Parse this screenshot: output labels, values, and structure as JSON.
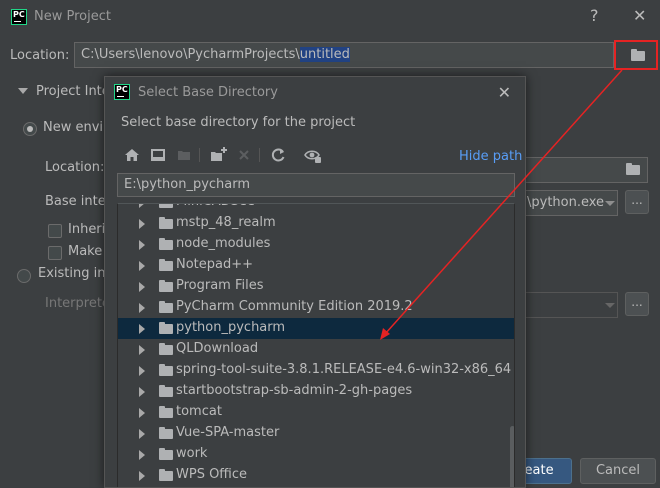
{
  "window": {
    "title": "New Project",
    "location_label": "Location:",
    "location_prefix": "C:\\Users\\lenovo\\PycharmProjects\\",
    "location_selected": "untitled",
    "interpreter_section": "Project Interpreter",
    "new_env_label": "New environment",
    "sub_location_label": "Location:",
    "base_interpreter_label": "Base interpreter",
    "base_interpreter_value": "\\python.exe",
    "inherit_label": "Inherit",
    "make_label": "Make",
    "existing_label": "Existing interpreter",
    "interpreter_label": "Interpreter",
    "create_button": "Create",
    "cancel_button": "Cancel",
    "browse_button": "..."
  },
  "dialog": {
    "title": "Select Base Directory",
    "description": "Select base directory for the project",
    "hide_path": "Hide path",
    "path_value": "E:\\python_pycharm",
    "items": [
      {
        "name": "MiniCADSee"
      },
      {
        "name": "mstp_48_realm"
      },
      {
        "name": "node_modules"
      },
      {
        "name": "Notepad++"
      },
      {
        "name": "Program Files"
      },
      {
        "name": "PyCharm Community Edition 2019.2"
      },
      {
        "name": "python_pycharm",
        "selected": true
      },
      {
        "name": "QLDownload"
      },
      {
        "name": "spring-tool-suite-3.8.1.RELEASE-e4.6-win32-x86_64"
      },
      {
        "name": "startbootstrap-sb-admin-2-gh-pages"
      },
      {
        "name": "tomcat"
      },
      {
        "name": "Vue-SPA-master"
      },
      {
        "name": "work"
      },
      {
        "name": "WPS Office"
      }
    ]
  },
  "icons": {
    "app": "pycharm-logo-icon",
    "toolbar": [
      "home-icon",
      "desktop-icon",
      "project-folder-icon",
      "new-folder-icon",
      "delete-icon",
      "refresh-icon",
      "show-hidden-icon"
    ]
  },
  "colors": {
    "background": "#3c3f41",
    "selection": "#214283",
    "tree_selected": "#0d293e",
    "link": "#589df6",
    "annotation": "#e52323",
    "primary_button": "#365880"
  }
}
